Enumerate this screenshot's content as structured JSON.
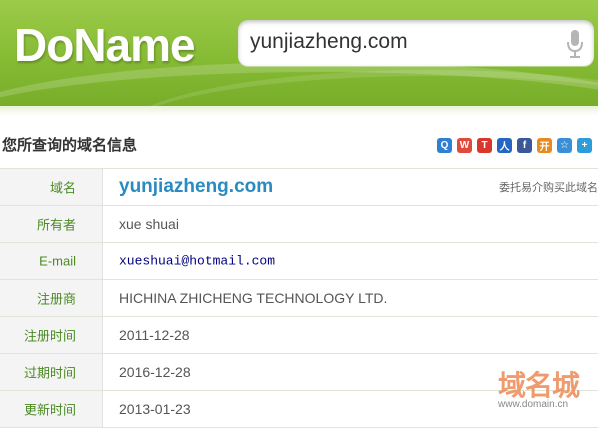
{
  "header": {
    "logo": "DoName",
    "search_value": "yunjiazheng.com"
  },
  "page": {
    "title": "您所查询的域名信息"
  },
  "share_icons": [
    {
      "name": "qzone-icon",
      "color": "#2f7fd3",
      "glyph": "Q"
    },
    {
      "name": "weibo-icon",
      "color": "#e04a3a",
      "glyph": "W"
    },
    {
      "name": "tencent-weibo-icon",
      "color": "#d9362e",
      "glyph": "T"
    },
    {
      "name": "renren-icon",
      "color": "#2565c3",
      "glyph": "人"
    },
    {
      "name": "facebook-icon",
      "color": "#3b5998",
      "glyph": "f"
    },
    {
      "name": "kaixin-icon",
      "color": "#e88a1c",
      "glyph": "开"
    },
    {
      "name": "favorite-icon",
      "color": "#3b8fd8",
      "glyph": "☆"
    },
    {
      "name": "more-share-icon",
      "color": "#2d9cdb",
      "glyph": "+"
    }
  ],
  "info": {
    "domain_label": "域名",
    "domain_value": "yunjiazheng.com",
    "domain_note": "委托易介购买此域名",
    "owner_label": "所有者",
    "owner_value": "xue shuai",
    "email_label": "E-mail",
    "email_value": "xueshuai@hotmail.com",
    "registrar_label": "注册商",
    "registrar_value": "HICHINA ZHICHENG TECHNOLOGY LTD.",
    "regdate_label": "注册时间",
    "regdate_value": "2011-12-28",
    "expdate_label": "过期时间",
    "expdate_value": "2016-12-28",
    "update_label": "更新时间",
    "update_value": "2013-01-23"
  },
  "watermark": {
    "logo": "域名城",
    "url": "www.domain.cn"
  }
}
